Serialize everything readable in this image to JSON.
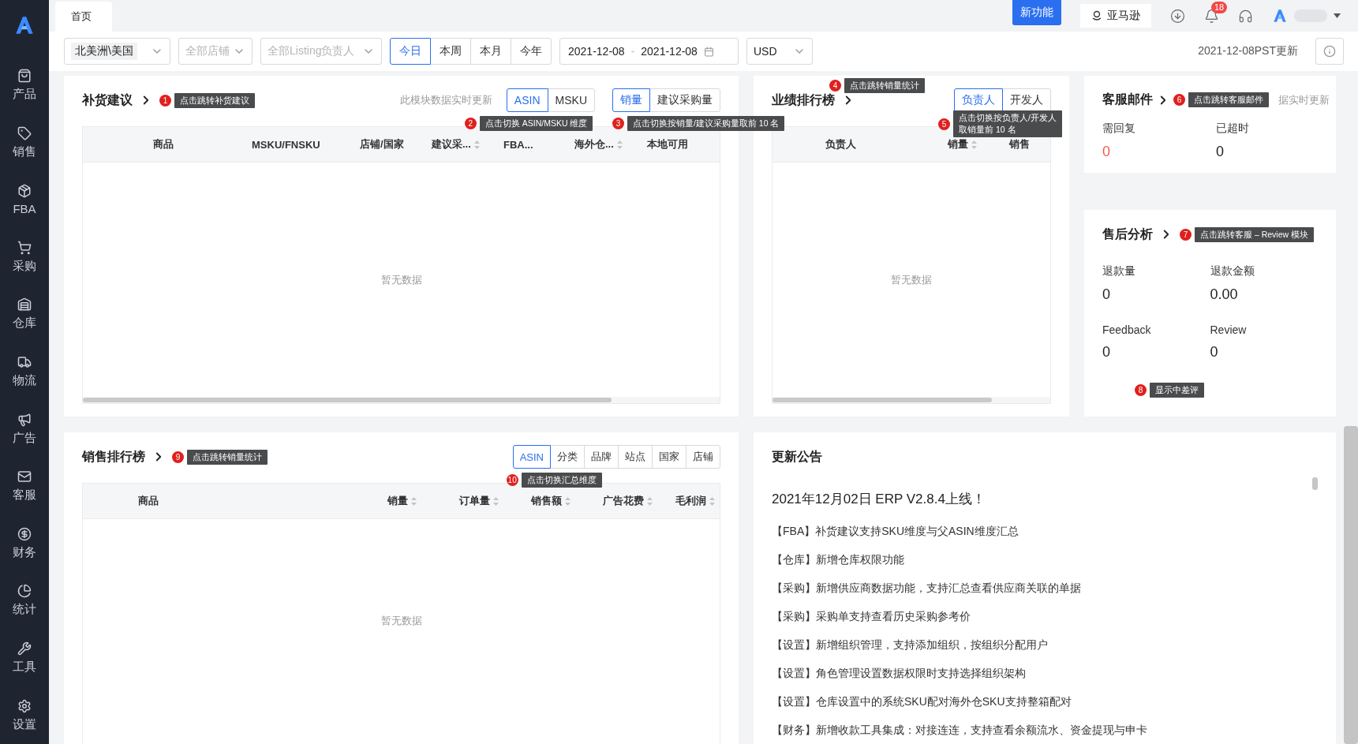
{
  "sidebar": {
    "items": [
      {
        "label": "产品"
      },
      {
        "label": "销售"
      },
      {
        "label": "FBA"
      },
      {
        "label": "采购"
      },
      {
        "label": "仓库"
      },
      {
        "label": "物流"
      },
      {
        "label": "广告"
      },
      {
        "label": "客服"
      },
      {
        "label": "财务"
      },
      {
        "label": "统计"
      },
      {
        "label": "工具"
      },
      {
        "label": "设置"
      }
    ]
  },
  "top_bar": {
    "tabs": [
      {
        "label": "首页",
        "selected": true
      }
    ],
    "new_feature_button": "新功能",
    "marketplace_button": "亚马逊",
    "notification_count": "18"
  },
  "filters": {
    "region": {
      "value": "北美洲\\美国"
    },
    "shop": {
      "placeholder": "全部店铺"
    },
    "listing_owner": {
      "placeholder": "全部Listing负责人"
    },
    "periods": [
      {
        "label": "今日",
        "selected": true
      },
      {
        "label": "本周",
        "selected": false
      },
      {
        "label": "本月",
        "selected": false
      },
      {
        "label": "今年",
        "selected": false
      }
    ],
    "date_start": "2021-12-08",
    "date_separator": "-",
    "date_end": "2021-12-08",
    "currency": "USD",
    "updated": "2021-12-08PST更新"
  },
  "replenishment": {
    "title": "补货建议",
    "callout": {
      "number": "1",
      "text": "点击跳转补货建议"
    },
    "note": "此模块数据实时更新",
    "toggles": [
      {
        "options": [
          {
            "label": "ASIN",
            "selected": true
          },
          {
            "label": "MSKU",
            "selected": false
          }
        ],
        "callout": {
          "number": "2",
          "text": "点击切换 ASIN/MSKU 维度"
        }
      },
      {
        "options": [
          {
            "label": "销量",
            "selected": true
          },
          {
            "label": "建议采购量",
            "selected": false
          }
        ],
        "callout": {
          "number": "3",
          "text": "点击切换按销量/建议采购量取前 10 名"
        }
      }
    ],
    "columns": [
      {
        "label": "商品",
        "sortable": false
      },
      {
        "label": "MSKU/FNSKU",
        "sortable": false
      },
      {
        "label": "店铺/国家",
        "sortable": false
      },
      {
        "label": "建议采...",
        "sortable": true
      },
      {
        "label": "FBA...",
        "sortable": false
      },
      {
        "label": "海外仓...",
        "sortable": true
      },
      {
        "label": "本地可用",
        "sortable": false
      }
    ],
    "empty": "暂无数据"
  },
  "performance": {
    "title": "业绩排行榜",
    "callout": {
      "number": "4",
      "text": "点击跳转销量统计"
    },
    "toggle": {
      "options": [
        {
          "label": "负责人",
          "selected": true
        },
        {
          "label": "开发人",
          "selected": false
        }
      ],
      "callout": {
        "number": "5",
        "lines": [
          "点击切换按负责人/开发人",
          "取销量前 10 名"
        ]
      }
    },
    "columns": [
      {
        "label": "负责人",
        "sortable": false
      },
      {
        "label": "销量",
        "sortable": true
      },
      {
        "label": "销售",
        "sortable": false
      }
    ],
    "empty": "暂无数据"
  },
  "service_mail": {
    "title": "客服邮件",
    "callout": {
      "number": "6",
      "text": "点击跳转客服邮件"
    },
    "note": "据实时更新",
    "stats": [
      {
        "label": "需回复",
        "value": "0",
        "alert": true
      },
      {
        "label": "已超时",
        "value": "0",
        "alert": false
      }
    ]
  },
  "after_sales": {
    "title": "售后分析",
    "callout": {
      "number": "7",
      "text": "点击跳转客服 – Review 模块"
    },
    "stats": [
      {
        "label": "退款量",
        "value": "0",
        "alert": false
      },
      {
        "label": "退款金额",
        "value": "0.00",
        "alert": false
      },
      {
        "label": "Feedback",
        "value": "0",
        "alert": false
      },
      {
        "label": "Review",
        "value": "0",
        "alert": false
      }
    ],
    "stats_callout": {
      "number": "8",
      "text": "显示中差评"
    }
  },
  "sales_ranking": {
    "title": "销售排行榜",
    "callout": {
      "number": "9",
      "text": "点击跳转销量统计"
    },
    "toggle": {
      "options": [
        {
          "label": "ASIN",
          "selected": true
        },
        {
          "label": "分类",
          "selected": false
        },
        {
          "label": "品牌",
          "selected": false
        },
        {
          "label": "站点",
          "selected": false
        },
        {
          "label": "国家",
          "selected": false
        },
        {
          "label": "店铺",
          "selected": false
        }
      ],
      "callout": {
        "number": "10",
        "text": "点击切换汇总维度"
      }
    },
    "columns": [
      {
        "label": "商品",
        "sortable": false
      },
      {
        "label": "销量",
        "sortable": true
      },
      {
        "label": "订单量",
        "sortable": true
      },
      {
        "label": "销售额",
        "sortable": true
      },
      {
        "label": "广告花费",
        "sortable": true
      },
      {
        "label": "毛利润",
        "sortable": true
      }
    ],
    "empty": "暂无数据"
  },
  "announcements": {
    "title": "更新公告",
    "headline": "2021年12月02日 ERP V2.8.4上线！",
    "items": [
      "【FBA】补货建议支持SKU维度与父ASIN维度汇总",
      "【仓库】新增仓库权限功能",
      "【采购】新增供应商数据功能，支持汇总查看供应商关联的单据",
      "【采购】采购单支持查看历史采购参考价",
      "【设置】新增组织管理，支持添加组织，按组织分配用户",
      "【设置】角色管理设置数据权限时支持选择组织架构",
      "【设置】仓库设置中的系统SKU配对海外仓SKU支持整箱配对",
      "【财务】新增收款工具集成：对接连连，支持查看余额流水、资金提现与申卡"
    ]
  }
}
